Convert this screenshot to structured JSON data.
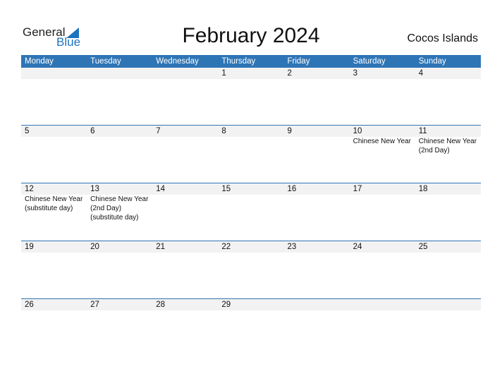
{
  "logo": {
    "text_general": "General",
    "text_blue": "Blue",
    "icon": "triangle-flag-icon",
    "brand_color": "#1e73be"
  },
  "title": "February 2024",
  "country": "Cocos Islands",
  "header_color": "#2e75b6",
  "weekdays": [
    "Monday",
    "Tuesday",
    "Wednesday",
    "Thursday",
    "Friday",
    "Saturday",
    "Sunday"
  ],
  "weeks": [
    {
      "days": [
        {
          "num": "",
          "events": ""
        },
        {
          "num": "",
          "events": ""
        },
        {
          "num": "",
          "events": ""
        },
        {
          "num": "1",
          "events": ""
        },
        {
          "num": "2",
          "events": ""
        },
        {
          "num": "3",
          "events": ""
        },
        {
          "num": "4",
          "events": ""
        }
      ]
    },
    {
      "days": [
        {
          "num": "5",
          "events": ""
        },
        {
          "num": "6",
          "events": ""
        },
        {
          "num": "7",
          "events": ""
        },
        {
          "num": "8",
          "events": ""
        },
        {
          "num": "9",
          "events": ""
        },
        {
          "num": "10",
          "events": "Chinese New Year"
        },
        {
          "num": "11",
          "events": "Chinese New Year\n(2nd Day)"
        }
      ]
    },
    {
      "days": [
        {
          "num": "12",
          "events": "Chinese New Year\n(substitute day)"
        },
        {
          "num": "13",
          "events": "Chinese New Year\n(2nd Day)\n(substitute day)"
        },
        {
          "num": "14",
          "events": ""
        },
        {
          "num": "15",
          "events": ""
        },
        {
          "num": "16",
          "events": ""
        },
        {
          "num": "17",
          "events": ""
        },
        {
          "num": "18",
          "events": ""
        }
      ]
    },
    {
      "days": [
        {
          "num": "19",
          "events": ""
        },
        {
          "num": "20",
          "events": ""
        },
        {
          "num": "21",
          "events": ""
        },
        {
          "num": "22",
          "events": ""
        },
        {
          "num": "23",
          "events": ""
        },
        {
          "num": "24",
          "events": ""
        },
        {
          "num": "25",
          "events": ""
        }
      ]
    },
    {
      "days": [
        {
          "num": "26",
          "events": ""
        },
        {
          "num": "27",
          "events": ""
        },
        {
          "num": "28",
          "events": ""
        },
        {
          "num": "29",
          "events": ""
        },
        {
          "num": "",
          "events": ""
        },
        {
          "num": "",
          "events": ""
        },
        {
          "num": "",
          "events": ""
        }
      ]
    }
  ]
}
